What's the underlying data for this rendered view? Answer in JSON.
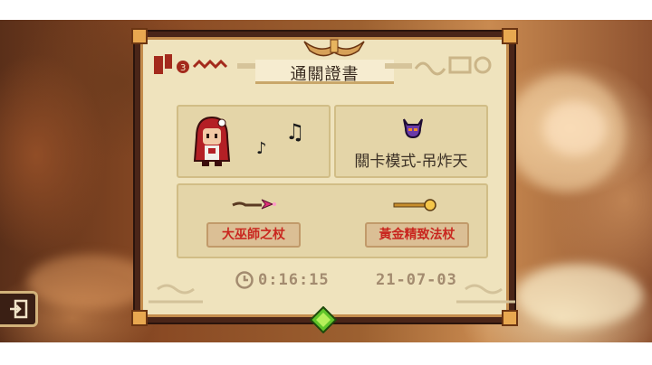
{
  "certificate": {
    "title": "通關證書",
    "mode_label": "關卡模式-吊炸天",
    "weapons": [
      {
        "name": "大巫師之杖",
        "icon": "pink-staff-icon"
      },
      {
        "name": "黃金精致法杖",
        "icon": "gold-staff-icon"
      }
    ],
    "time": "0:16:15",
    "date": "21-07-03",
    "hero_icon": "red-hood-girl-icon",
    "mode_icon": "purple-demon-helmet-icon"
  },
  "colors": {
    "parchment": "#efe3bd",
    "panel": "#e4d5a8",
    "frame": "#4a2518",
    "weapon_text": "#c9261f",
    "footer_text": "#a38b6f"
  }
}
